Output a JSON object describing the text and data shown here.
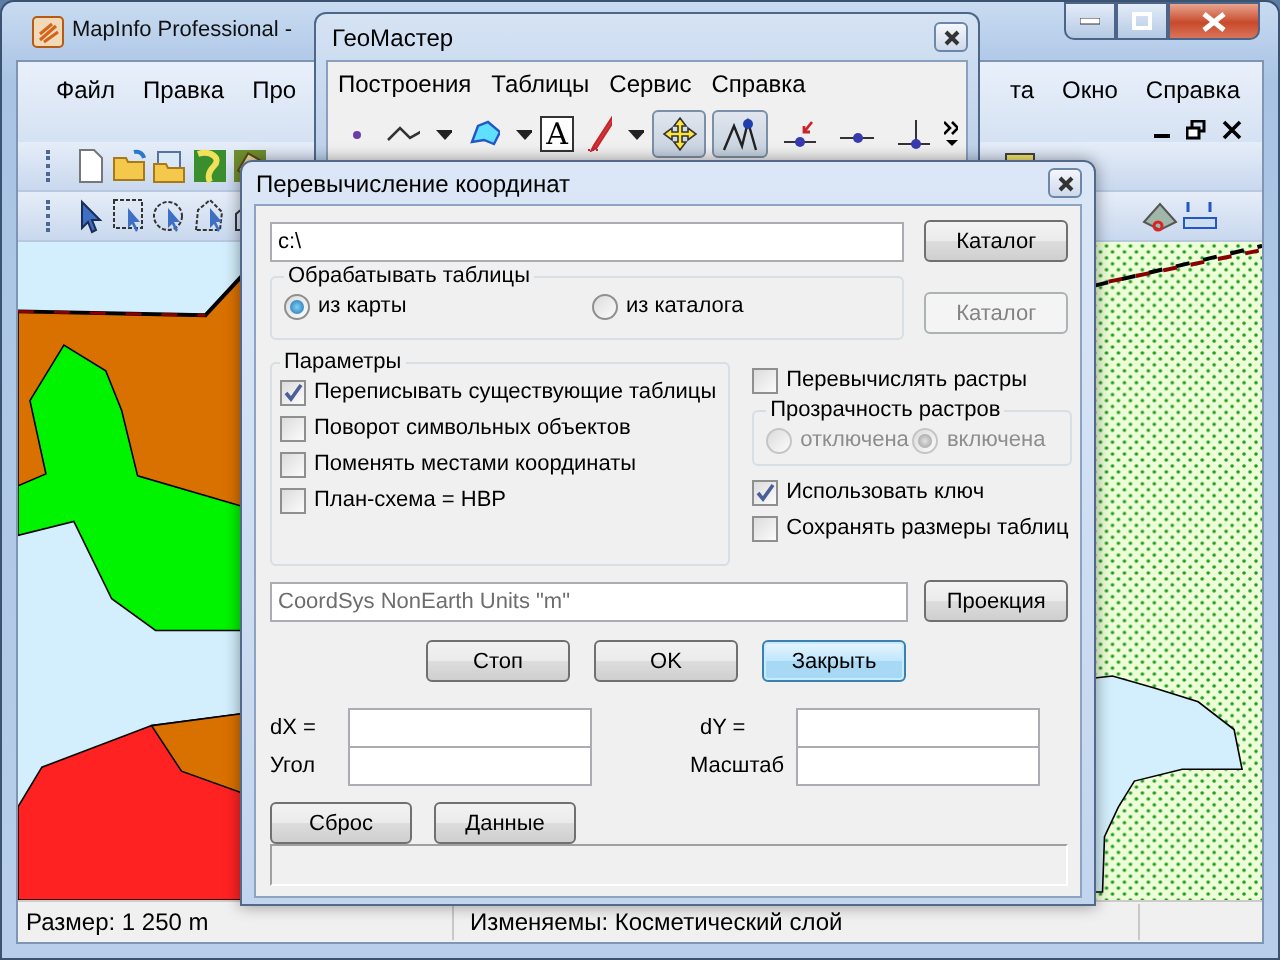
{
  "main_window": {
    "title": "MapInfo Professional -",
    "menu": [
      {
        "label": "Файл"
      },
      {
        "label": "Правка"
      },
      {
        "label": "Про"
      }
    ],
    "menu_right": [
      {
        "label": "та"
      },
      {
        "label": "Окно"
      },
      {
        "label": "Справка"
      }
    ],
    "status_bar": {
      "scale": "Размер: 1 250 m",
      "editable_layer": "Изменяемы: Косметический слой"
    }
  },
  "geomaster": {
    "title": "ГеоМастер",
    "menu": [
      "Построения",
      "Таблицы",
      "Сервис",
      "Справка"
    ],
    "tools": [
      {
        "kind": "point",
        "selected": false
      },
      {
        "kind": "polyline",
        "selected": false
      },
      {
        "kind": "caret",
        "selected": false
      },
      {
        "kind": "polygon",
        "selected": false
      },
      {
        "kind": "caret",
        "selected": false
      },
      {
        "kind": "text",
        "label": "A",
        "selected": false
      },
      {
        "kind": "pencil",
        "selected": false
      },
      {
        "kind": "caret",
        "selected": false
      },
      {
        "kind": "move",
        "selected": true
      },
      {
        "kind": "vertex",
        "selected": true
      },
      {
        "kind": "node-arrow",
        "selected": false
      },
      {
        "kind": "node",
        "selected": false
      },
      {
        "kind": "node-stem",
        "selected": false
      }
    ]
  },
  "dialog": {
    "title": "Перевычисление координат",
    "folder": {
      "value": "c:\\",
      "button": "Каталог"
    },
    "source_group": {
      "legend": "Обрабатывать таблицы",
      "options": [
        {
          "label": "из карты",
          "selected": true
        },
        {
          "label": "из каталога",
          "selected": false
        }
      ],
      "button": {
        "label": "Каталог",
        "disabled": true
      }
    },
    "parameters": {
      "legend": "Параметры",
      "options": [
        {
          "label": "Переписывать существующие таблицы",
          "checked": true
        },
        {
          "label": "Поворот символьных объектов",
          "checked": false
        },
        {
          "label": "Поменять местами координаты",
          "checked": false
        },
        {
          "label": "План-схема = НВР",
          "checked": false
        }
      ]
    },
    "recalc_rasters": {
      "label": "Перевычислять растры",
      "checked": false
    },
    "transparency": {
      "legend": "Прозрачность растров",
      "disabled": true,
      "options": [
        {
          "label": "отключена",
          "selected": false
        },
        {
          "label": "включена",
          "selected": true
        }
      ]
    },
    "extra_options": [
      {
        "label": "Использовать ключ",
        "checked": true
      },
      {
        "label": "Сохранять размеры таблиц",
        "checked": false
      }
    ],
    "projection": {
      "value": "CoordSys NonEarth Units \"m\"",
      "disabled": true,
      "button": "Проекция"
    },
    "actions": [
      {
        "label": "Стоп",
        "default": false
      },
      {
        "label": "OK",
        "default": false
      },
      {
        "label": "Закрыть",
        "default": true
      }
    ],
    "offsets": [
      {
        "label": "dX  ="
      },
      {
        "label": "dY  ="
      },
      {
        "label": "Угол"
      },
      {
        "label": "Масштаб"
      }
    ],
    "bottom_buttons": [
      "Сброс",
      "Данные"
    ]
  }
}
